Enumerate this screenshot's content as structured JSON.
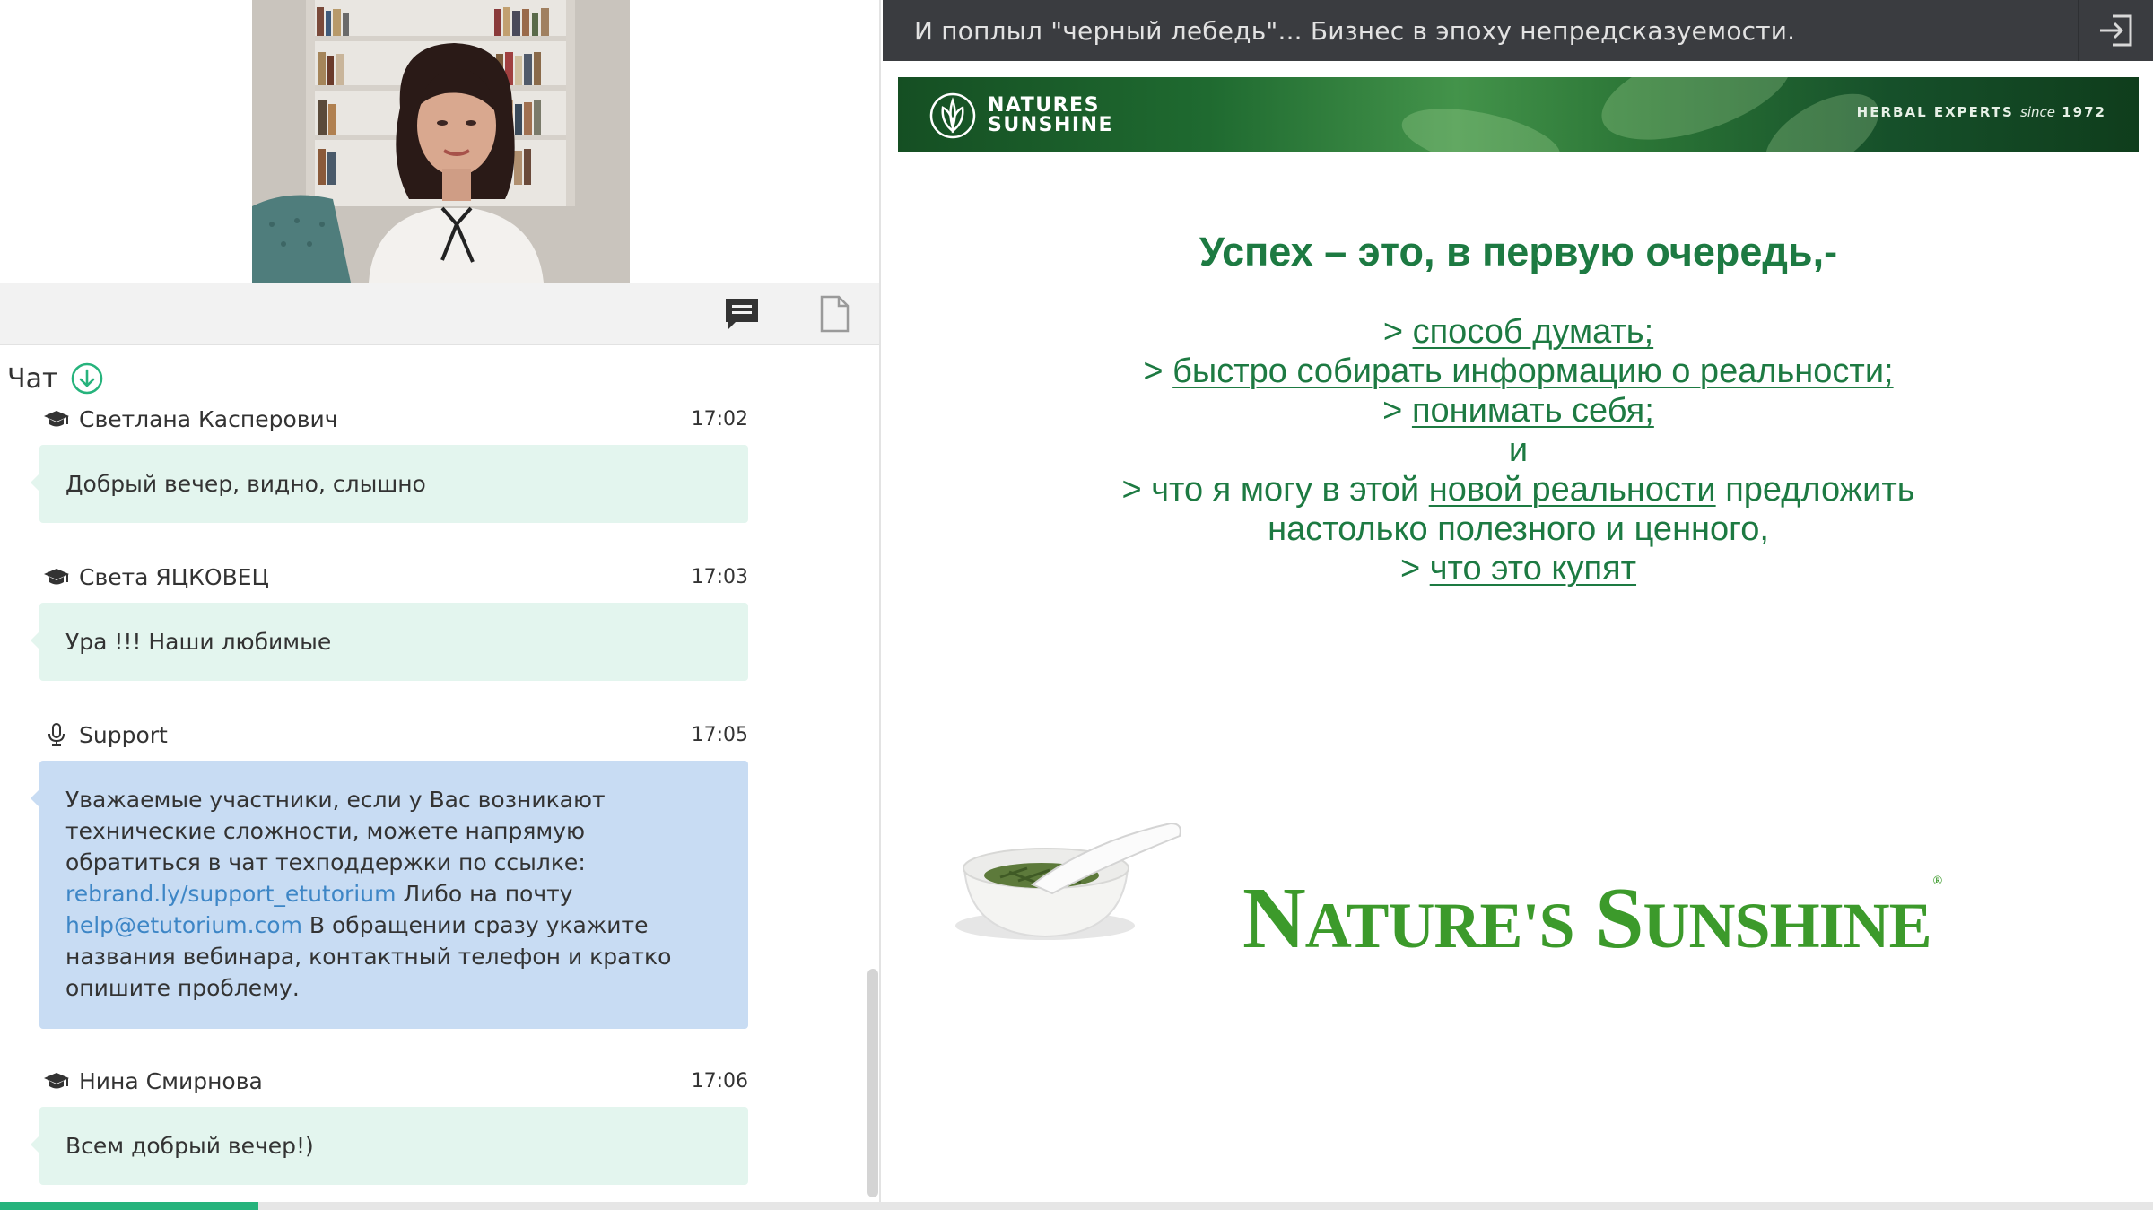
{
  "window": {
    "title": "И поплыл \"черный лебедь\"... Бизнес в эпоху непредсказуемости."
  },
  "toolbar": {
    "chat_icon": "chat-icon",
    "files_icon": "document-icon"
  },
  "chat": {
    "title": "Чат",
    "messages": [
      {
        "author": "Светлана Касперович",
        "time": "17:02",
        "role_icon": "graduation-cap-icon",
        "text": "Добрый вечер, видно, слышно"
      },
      {
        "author": "Света ЯЦКОВЕЦ",
        "time": "17:03",
        "role_icon": "graduation-cap-icon",
        "text": "Ура !!! Наши любимые"
      },
      {
        "author": "Support",
        "time": "17:05",
        "role_icon": "microphone-icon",
        "text_part1": "Уважаемые участники, если у Вас возникают технические сложности, можете напрямую обратиться в чат техподдержки по ссылке:",
        "link1": "rebrand.ly/support_etutorium",
        "text_part2": "Либо на почту",
        "link2": "help@etutorium.com",
        "text_part3": "В обращении сразу укажите названия вебинара, контактный телефон и кратко опишите проблему."
      },
      {
        "author": "Нина Смирнова",
        "time": "17:06",
        "role_icon": "graduation-cap-icon",
        "text": "Всем добрый вечер!)"
      }
    ]
  },
  "playback": {
    "progress": 0.12
  },
  "slide": {
    "banner_brand_line1": "NATURES",
    "banner_brand_line2": "SUNSHINE",
    "banner_tagline_a": "HERBAL EXPERTS",
    "banner_tagline_since": "since",
    "banner_tagline_year": "1972",
    "heading": "Успех – это, в первую очередь,-",
    "lines": {
      "l1_prefix": ">",
      "l1_u": "способ думать;",
      "l2_prefix": ">",
      "l2_u": "быстро собирать информацию о реальности;",
      "l3_prefix": ">",
      "l3_u": "понимать себя;",
      "l4": "и",
      "l5_prefix": "> что я могу в этой",
      "l5_u": "новой реальности",
      "l5_suffix": "предложить",
      "l6": "настолько полезного и ценного,",
      "l7_prefix": ">",
      "l7_u": "что это купят"
    },
    "wordmark": {
      "n_cap": "N",
      "n_rest": "ATURE",
      "apos_s": "'S",
      "s_cap": "S",
      "s_rest": "UNSHINE",
      "reg": "®"
    }
  },
  "colors": {
    "accent_green": "#26b37c",
    "slide_green": "#1d7a42",
    "user_bubble": "#e3f5ee",
    "support_bubble": "#c8dcf3",
    "link_blue": "#3d86c6",
    "title_bar": "#3a3c40"
  }
}
